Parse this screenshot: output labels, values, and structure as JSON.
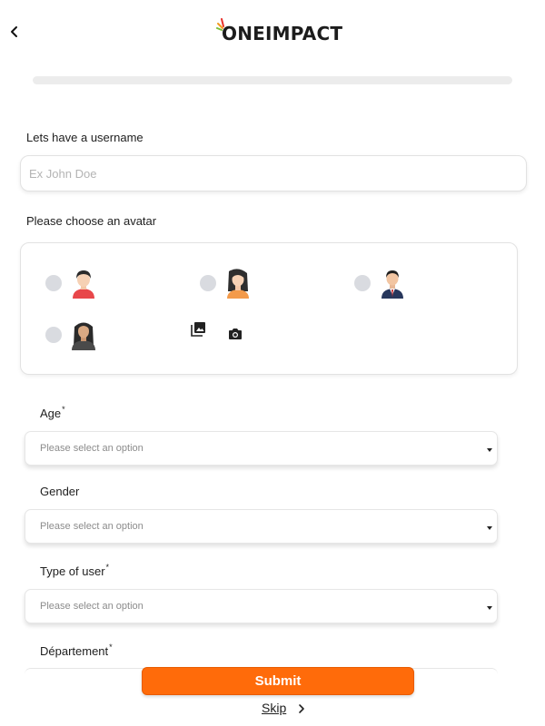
{
  "header": {
    "logo_text": "ONEIMPACT",
    "back_icon": "chevron-left-icon"
  },
  "progress": {
    "value": 0
  },
  "username": {
    "label": "Lets have a username",
    "placeholder": "Ex John Doe",
    "value": ""
  },
  "avatar_section": {
    "label": "Please choose an avatar",
    "options": [
      {
        "icon": "avatar-man-red-shirt-icon"
      },
      {
        "icon": "avatar-woman-orange-top-icon"
      },
      {
        "icon": "avatar-man-suit-icon"
      },
      {
        "icon": "avatar-woman-dark-jacket-icon"
      }
    ],
    "gallery_icon": "photo-library-icon",
    "camera_icon": "camera-icon"
  },
  "fields": {
    "age": {
      "label": "Age",
      "required_mark": "*",
      "placeholder": "Please select an option"
    },
    "gender": {
      "label": "Gender",
      "placeholder": "Please select an option"
    },
    "user_type": {
      "label": "Type of user",
      "required_mark": "*",
      "placeholder": "Please select an option"
    },
    "department": {
      "label": "Département",
      "required_mark": "*"
    }
  },
  "actions": {
    "submit_label": "Submit",
    "skip_label": "Skip"
  },
  "colors": {
    "accent": "#ff6b0a",
    "radio": "#d9dbe0",
    "progress_track": "#ececec"
  }
}
